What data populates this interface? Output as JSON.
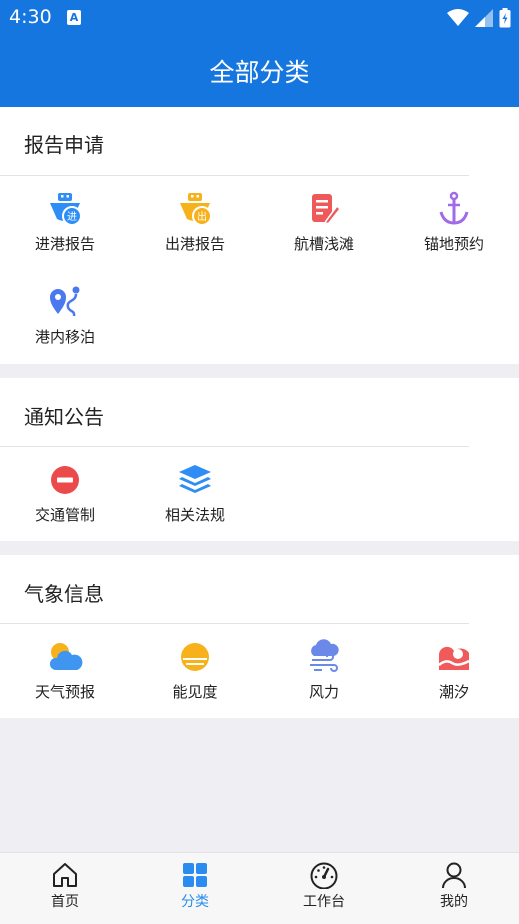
{
  "status_bar": {
    "time": "4:30",
    "notification_icon": "a-icon"
  },
  "header": {
    "title": "全部分类"
  },
  "sections": [
    {
      "title": "报告申请",
      "items": [
        {
          "label": "进港报告",
          "icon": "ship-in-icon",
          "color": "#2f8ef5",
          "badge": "进"
        },
        {
          "label": "出港报告",
          "icon": "ship-out-icon",
          "color": "#f7b21b",
          "badge": "出"
        },
        {
          "label": "航槽浅滩",
          "icon": "edit-doc-icon",
          "color": "#ee5a5a"
        },
        {
          "label": "锚地预约",
          "icon": "anchor-icon",
          "color": "#a06ae8"
        },
        {
          "label": "港内移泊",
          "icon": "route-map-icon",
          "color": "#4a79ef"
        }
      ]
    },
    {
      "title": "通知公告",
      "items": [
        {
          "label": "交通管制",
          "icon": "no-entry-icon",
          "color": "#ec4a4a"
        },
        {
          "label": "相关法规",
          "icon": "layers-icon",
          "color": "#2f8ef5"
        }
      ]
    },
    {
      "title": "气象信息",
      "items": [
        {
          "label": "天气预报",
          "icon": "sun-cloud-icon",
          "color": "#3f95f0"
        },
        {
          "label": "能见度",
          "icon": "sun-horizon-icon",
          "color": "#f7b21b"
        },
        {
          "label": "风力",
          "icon": "wind-icon",
          "color": "#6b89e8"
        },
        {
          "label": "潮汐",
          "icon": "tide-icon",
          "color": "#f05a5a"
        }
      ]
    }
  ],
  "bottom_nav": [
    {
      "label": "首页",
      "icon": "home-icon",
      "active": false
    },
    {
      "label": "分类",
      "icon": "grid-icon",
      "active": true
    },
    {
      "label": "工作台",
      "icon": "dashboard-icon",
      "active": false
    },
    {
      "label": "我的",
      "icon": "user-icon",
      "active": false
    }
  ],
  "colors": {
    "header": "#1476de",
    "active_tab": "#2a8cf0",
    "background": "#eeeef3"
  }
}
